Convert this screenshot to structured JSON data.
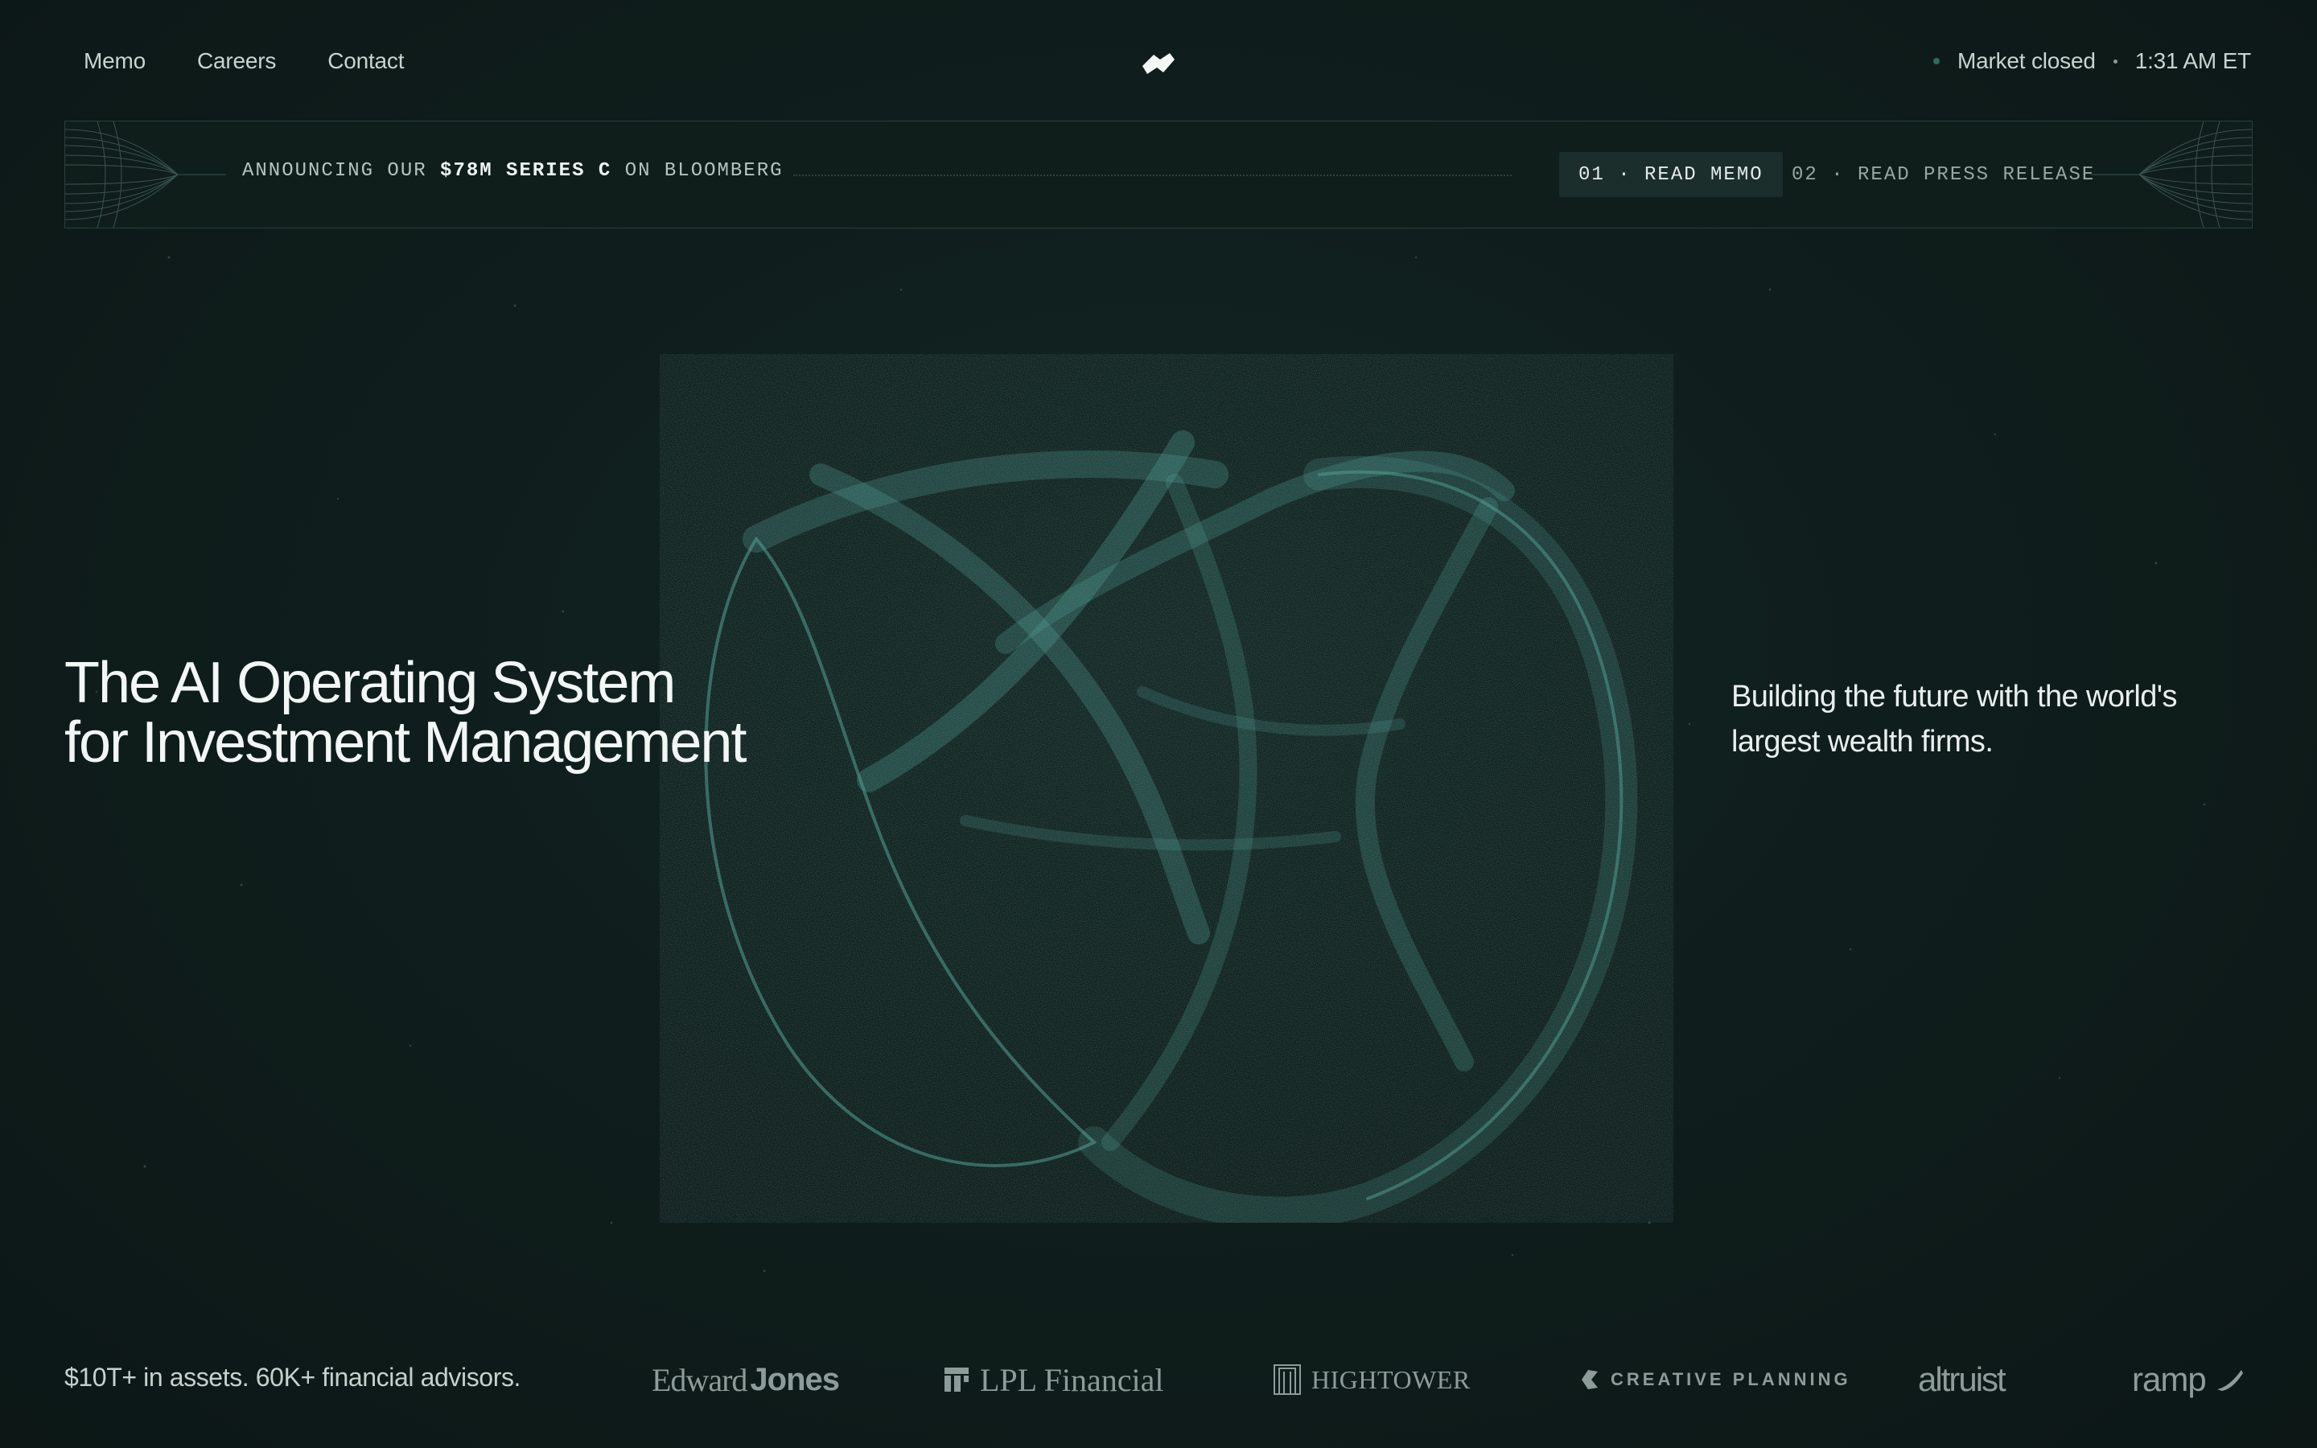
{
  "nav": {
    "links": [
      "Memo",
      "Careers",
      "Contact"
    ],
    "market_status": "Market closed",
    "time": "1:31 AM ET"
  },
  "banner": {
    "announce_prefix": "ANNOUNCING OUR",
    "announce_bold": "$78M SERIES C",
    "announce_suffix": "ON BLOOMBERG",
    "btn_memo": "01 · READ MEMO",
    "btn_press": "02 · READ PRESS RELEASE"
  },
  "hero": {
    "title_line1": "The AI Operating System",
    "title_line2": "for Investment Management",
    "subtitle": "Building the future with the world's largest wealth firms."
  },
  "footer": {
    "stat": "$10T+ in assets. 60K+ financial advisors.",
    "logos": {
      "edward_a": "Edward",
      "edward_b": "Jones",
      "lpl": "LPL Financial",
      "hightower": "HIGHTOWER",
      "creative": "CREATIVE PLANNING",
      "altruist": "altruist",
      "ramp": "ramp"
    }
  },
  "colors": {
    "background": "#0f1e1c",
    "accent_teal": "#5fb3a7",
    "text": "#f2f6f5",
    "muted": "#8e9c99"
  },
  "icons": [
    "brand-logo-icon",
    "market-status-dot-icon",
    "lpl-mark-icon",
    "hightower-mark-icon",
    "creative-planning-mark-icon",
    "ramp-mark-icon"
  ]
}
